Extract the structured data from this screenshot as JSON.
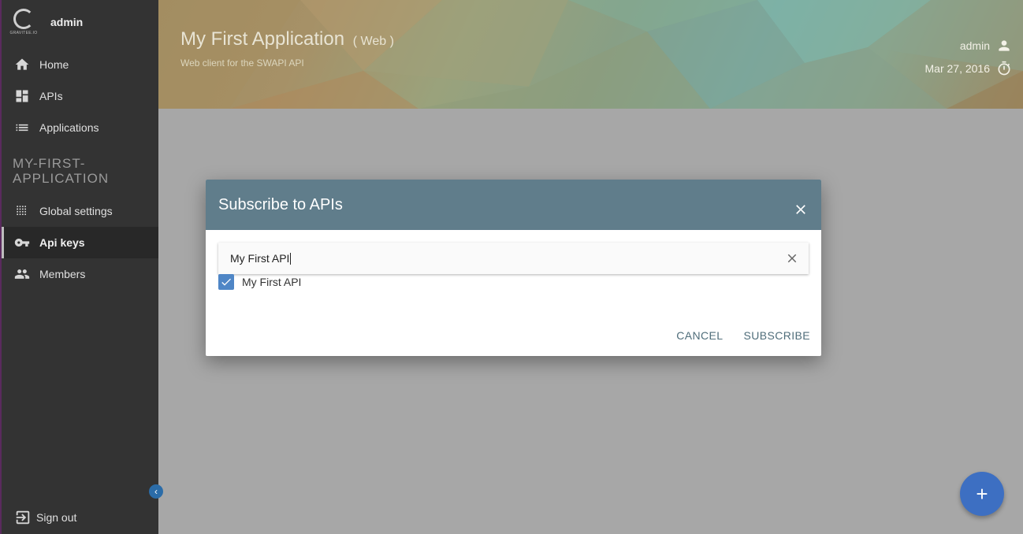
{
  "sidebar": {
    "logo_text": "GRAVITEE.IO",
    "user": "admin",
    "nav": [
      {
        "label": "Home",
        "icon": "home-icon"
      },
      {
        "label": "APIs",
        "icon": "dashboard-icon"
      },
      {
        "label": "Applications",
        "icon": "list-icon"
      }
    ],
    "section_title": "MY-FIRST-APPLICATION",
    "section_items": [
      {
        "label": "Global settings",
        "icon": "grid-icon",
        "active": false
      },
      {
        "label": "Api keys",
        "icon": "key-icon",
        "active": true
      },
      {
        "label": "Members",
        "icon": "people-icon",
        "active": false
      }
    ],
    "collapse_glyph": "‹",
    "signout_label": "Sign out"
  },
  "header": {
    "title": "My First Application",
    "type": "( Web )",
    "description": "Web client for the SWAPI API",
    "user": "admin",
    "date": "Mar 27, 2016"
  },
  "dialog": {
    "title": "Subscribe to APIs",
    "search_value": "My First API",
    "results": [
      {
        "label": "My First API",
        "checked": true
      }
    ],
    "cancel_label": "CANCEL",
    "subscribe_label": "SUBSCRIBE"
  },
  "fab": {
    "label": "+"
  },
  "colors": {
    "sidebar_bg": "#333333",
    "dialog_header": "#607d8b",
    "accent": "#3d6fc2",
    "checkbox": "#4f86c6"
  }
}
